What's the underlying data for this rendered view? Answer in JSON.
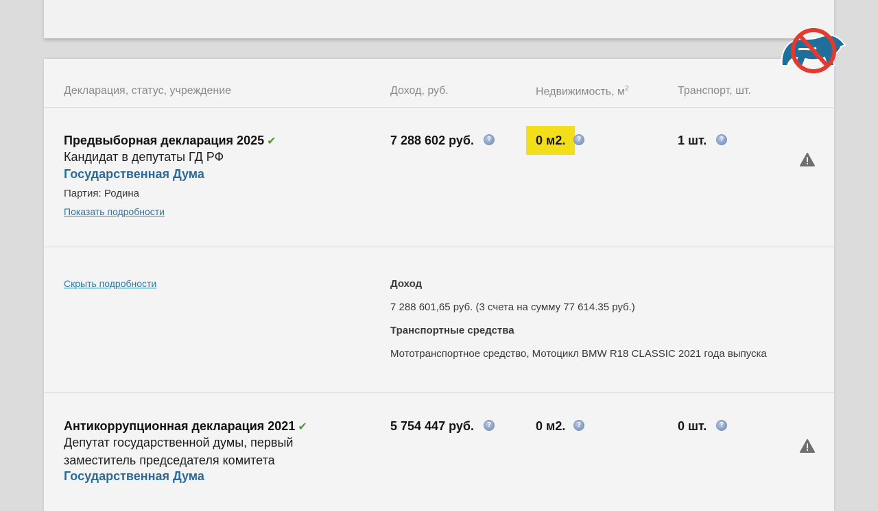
{
  "headers": {
    "declaration": "Декларация, статус, учреждение",
    "income": "Доход, руб.",
    "realty": "Недвижимость, м",
    "realty_sup": "2",
    "transport": "Транспорт, шт."
  },
  "rows": [
    {
      "title": "Предвыборная декларация 2025",
      "check": "✔",
      "role_lines": [
        "Кандидат в депутаты ГД РФ"
      ],
      "institution": "Государственная Дума",
      "party": "Партия: Родина",
      "details_link": "Показать подробности",
      "income": "7 288 602 руб.",
      "realty": "0 м2.",
      "transport": "1 шт."
    },
    {
      "title": "Антикоррупционная декларация 2021",
      "check": "✔",
      "role_lines": [
        "Депутат государственной думы, первый",
        "заместитель председателя комитета"
      ],
      "institution": "Государственная Дума",
      "income": "5 754 447 руб.",
      "realty": "0 м2.",
      "transport": "0 шт."
    }
  ],
  "details": {
    "hide_link": "Скрыть подробности",
    "income_heading": "Доход",
    "income_text": "7 288 601,65 руб. (3 счета на сумму 77 614.35 руб.)",
    "transport_heading": "Транспортные средства",
    "transport_text": "Мототранспортное средство, Мотоцикл BMW R18 CLASSIC 2021 года выпуска"
  },
  "icons": {
    "info": "?",
    "warning": "warning-triangle-icon",
    "logo": "crossed-bear-logo"
  },
  "colors": {
    "highlight": "#f2df1a",
    "link": "#2a7aa6",
    "institution": "#2e6a96",
    "check": "#4a9c3a"
  }
}
